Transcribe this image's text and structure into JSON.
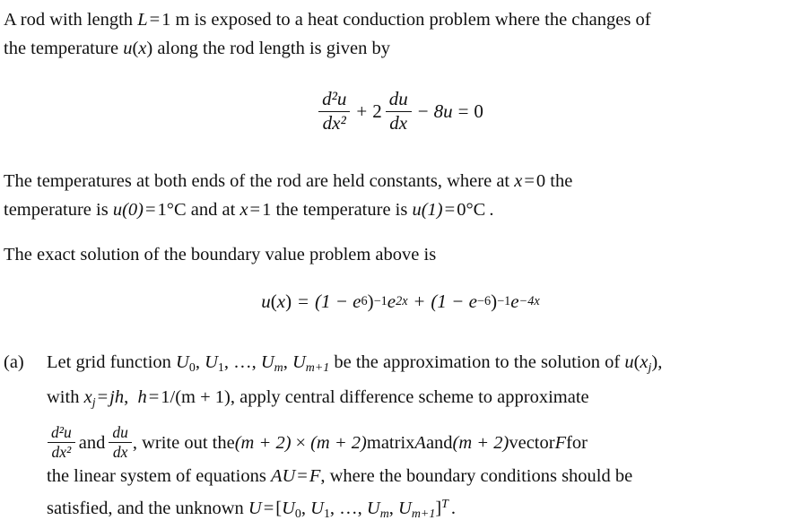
{
  "document": {
    "type": "math-homework-problem",
    "background_color": "#ffffff",
    "text_color": "#111111",
    "paragraphs": {
      "intro_line1": "A rod with length L = 1 m is exposed to a heat conduction problem where the changes of",
      "intro_line2": "the temperature u(x) along the rod length is given by",
      "bc_line1": "The temperatures at both ends of the rod are held constants, where at x = 0  the",
      "bc_line2": "temperature is u(0) = 1°C  and at x = 1  the temperature is u(1) = 0°C .",
      "exact_intro": "The exact solution of the boundary value problem above is"
    },
    "intro": {
      "t1": "A rod with length ",
      "var_L": "L",
      "eq1": "=",
      "val_1m": "1 m",
      "t2": " is exposed to a heat conduction problem where the changes of",
      "t3": "the temperature ",
      "var_u": "u",
      "paren_open": "(",
      "var_x": "x",
      "paren_close": ")",
      "t4": " along the rod length is given by"
    },
    "equation_ode": {
      "label": "governing-ode",
      "num1": "d²u",
      "den1": "dx²",
      "plus": "+",
      "coef2": "2",
      "num2": "du",
      "den2": "dx",
      "minus": "−",
      "term8u": "8u",
      "equals": "=",
      "rhs": "0",
      "plain": "d²u/dx² + 2 du/dx − 8u = 0"
    },
    "boundary": {
      "s1": "The temperatures at both ends of the rod are held constants, where at ",
      "x_var": "x",
      "eq": "=",
      "zero": "0",
      "s2": "  the",
      "s3": "temperature is ",
      "u0": "u(0)",
      "one_c": "1°C",
      "s4": "  and at ",
      "x_var2": "x",
      "one": "1",
      "s5": "  the temperature is ",
      "u1": "u(1)",
      "zero_c": "0°C",
      "period": "."
    },
    "exact_solution": {
      "intro": "The exact solution of the boundary value problem above is",
      "lhs_u": "u",
      "lhs_x": "x",
      "equals": "=",
      "term1_base": "(1 − e",
      "term1_exp": "6",
      "term1_close": ")",
      "term1_pow": "−1",
      "term1_e": "e",
      "term1_e_exp": "2x",
      "plus": "+",
      "term2_base": "(1 − e",
      "term2_exp": "−6",
      "term2_close": ")",
      "term2_pow": "−1",
      "term2_e": "e",
      "term2_e_exp": "−4x",
      "plain": "u(x) = (1 − e⁶)⁻¹e²ˣ + (1 − e⁻⁶)⁻¹e⁻⁴ˣ"
    },
    "part_a": {
      "marker": "(a)",
      "line1_a": "Let grid function ",
      "U0": "U",
      "U0_sub": "0",
      "comma1": ", ",
      "U1": "U",
      "U1_sub": "1",
      "comma2": ", ",
      "ellipsis": "…",
      "comma3": ", ",
      "Um": "U",
      "Um_sub": "m",
      "comma4": ", ",
      "Um1": "U",
      "Um1_sub": "m+1",
      "line1_b": " be the approximation to the solution of ",
      "u_xj_u": "u",
      "u_xj_x": "x",
      "u_xj_sub": "j",
      "line1_c": ",",
      "line2_a": "with  ",
      "xj_x": "x",
      "xj_sub": "j",
      "eq1": "=",
      "jh": "jh",
      "comma5": ",",
      "h": "h",
      "eq2": "=",
      "frac_h": "1/(m + 1)",
      "line2_b": ", apply central difference scheme to approximate",
      "frac1_num": "d²u",
      "frac1_den": "dx²",
      "and_word": " and ",
      "frac2_num": "du",
      "frac2_den": "dx",
      "line3_a": ", write out the ",
      "mp2_1": "(m + 2)",
      "times": "×",
      "mp2_2": "(m + 2)",
      "line3_b": " matrix ",
      "matrix_A": "A",
      "line3_c": " and ",
      "mp2_3": "(m + 2)",
      "line3_d": " vector ",
      "vector_F": "F",
      "line3_e": " for",
      "line4_a": "the linear system of equations ",
      "AU": "AU",
      "eq3": "=",
      "F": "F",
      "line4_b": ",   where the boundary conditions should be",
      "line5_a": "satisfied, and the unknown ",
      "U": "U",
      "eq4": "=",
      "bracket_open": "[",
      "v_U0": "U",
      "v_U0_sub": "0",
      "v_comma1": ", ",
      "v_U1": "U",
      "v_U1_sub": "1",
      "v_comma2": ", ",
      "v_ellipsis": "…",
      "v_comma3": ", ",
      "v_Um": "U",
      "v_Um_sub": "m",
      "v_comma4": ", ",
      "v_Um1": "U",
      "v_Um1_sub": "m+1",
      "bracket_close": "]",
      "transpose": "T",
      "final_period": "."
    }
  }
}
